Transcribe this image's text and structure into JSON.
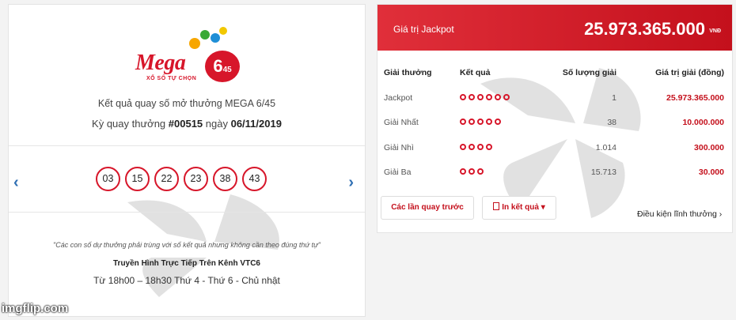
{
  "logo": {
    "brand": "Mega",
    "number": "6",
    "sub_number": "45",
    "tagline": "XỔ SỐ TỰ CHỌN"
  },
  "result": {
    "title": "Kết quả quay số mở thưởng MEGA 6/45",
    "draw_prefix": "Kỳ quay thưởng ",
    "draw_number": "#00515",
    "date_prefix": " ngày ",
    "date": "06/11/2019",
    "numbers": [
      "03",
      "15",
      "22",
      "23",
      "38",
      "43"
    ],
    "prev_label": "‹",
    "next_label": "›"
  },
  "info": {
    "note": "\"Các con số dự thưởng phải trùng với số kết quả nhưng không cần theo đúng thứ tự\"",
    "channel": "Truyền Hình Trực Tiếp Trên Kênh VTC6",
    "schedule": "Từ 18h00 – 18h30 Thứ 4 - Thứ 6 - Chủ nhật"
  },
  "jackpot": {
    "label": "Giá trị Jackpot",
    "value": "25.973.365.000",
    "unit": "VNĐ"
  },
  "table": {
    "headers": [
      "Giải thưởng",
      "Kết quả",
      "Số lượng giải",
      "Giá trị giải (đồng)"
    ],
    "rows": [
      {
        "name": "Jackpot",
        "matches": 6,
        "count": "1",
        "value": "25.973.365.000"
      },
      {
        "name": "Giải Nhất",
        "matches": 5,
        "count": "38",
        "value": "10.000.000"
      },
      {
        "name": "Giải Nhì",
        "matches": 4,
        "count": "1.014",
        "value": "300.000"
      },
      {
        "name": "Giải Ba",
        "matches": 3,
        "count": "15.713",
        "value": "30.000"
      }
    ]
  },
  "actions": {
    "previous_draws": "Các lần quay trước",
    "print_results": "In kết quả ▾",
    "conditions": "Điều kiện lĩnh thưởng ›"
  },
  "watermark": "imgflip.com",
  "colors": {
    "accent": "#d7162a",
    "jackpot_bar": "#c4101c",
    "nav": "#2f6fb3"
  }
}
